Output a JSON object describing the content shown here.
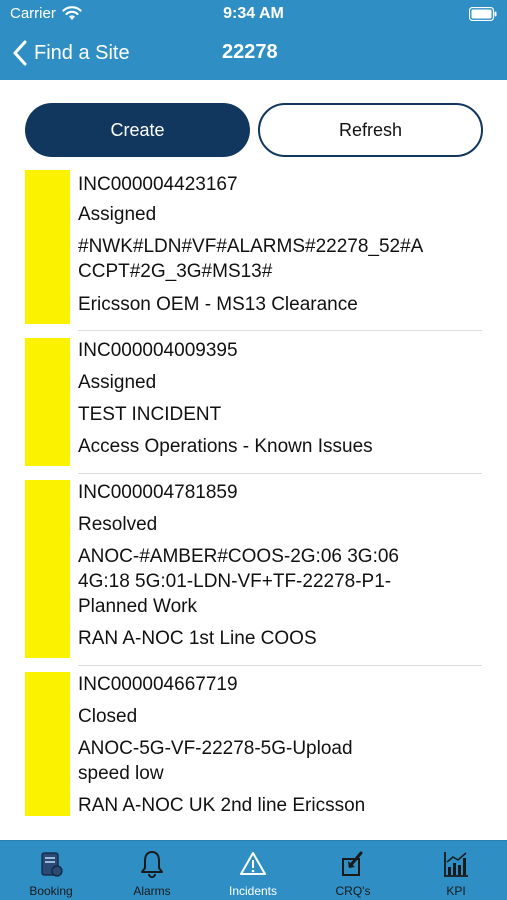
{
  "status_bar": {
    "carrier": "Carrier",
    "time": "9:34 AM"
  },
  "nav": {
    "back_label": "Find a Site",
    "title": "22278"
  },
  "actions": {
    "create_label": "Create",
    "refresh_label": "Refresh"
  },
  "incidents": [
    {
      "id": "INC000004423167",
      "status": "Assigned",
      "summary": [
        "#NWK#LDN#VF#ALARMS#22278_52#A",
        "CCPT#2G_3G#MS13#"
      ],
      "group": "Ericsson OEM - MS13 Clearance",
      "bar_color": "#fbf200"
    },
    {
      "id": "INC000004009395",
      "status": "Assigned",
      "summary": [
        "TEST INCIDENT"
      ],
      "group": "Access Operations - Known Issues",
      "bar_color": "#fbf200"
    },
    {
      "id": "INC000004781859",
      "status": "Resolved",
      "summary": [
        "ANOC-#AMBER#COOS-2G:06 3G:06",
        "4G:18 5G:01-LDN-VF+TF-22278-P1-",
        "Planned Work"
      ],
      "group": "RAN A-NOC 1st Line COOS",
      "bar_color": "#fbf200"
    },
    {
      "id": "INC000004667719",
      "status": "Closed",
      "summary": [
        "ANOC-5G-VF-22278-5G-Upload",
        "speed low"
      ],
      "group": "RAN A-NOC UK 2nd line Ericsson",
      "bar_color": "#fbf200"
    }
  ],
  "tabs": [
    {
      "label": "Booking",
      "icon": "booking-icon"
    },
    {
      "label": "Alarms",
      "icon": "bell-icon"
    },
    {
      "label": "Incidents",
      "icon": "warning-icon",
      "active": true
    },
    {
      "label": "CRQ's",
      "icon": "change-request-icon"
    },
    {
      "label": "KPI",
      "icon": "chart-icon"
    }
  ],
  "colors": {
    "header": "#2f8fc5",
    "primary_button": "#11375f",
    "incident_bar": "#fbf200",
    "active_tab": "#ffffff"
  }
}
